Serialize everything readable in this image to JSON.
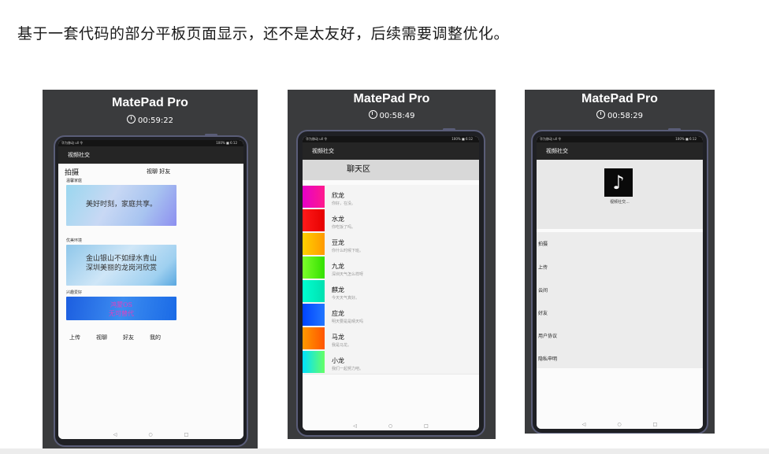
{
  "caption": "基于一套代码的部分平板页面显示，还不是太友好，后续需要调整优化。",
  "device_title": "MatePad Pro",
  "panels": [
    {
      "timer": "00:59:22"
    },
    {
      "timer": "00:58:49"
    },
    {
      "timer": "00:58:29"
    }
  ],
  "status": {
    "left": "华为移动 ull 令",
    "right": "100% ■ 6:12"
  },
  "app_title": "视频社交",
  "nav": {
    "back": "◁",
    "home": "○",
    "recent": "□"
  },
  "colors": {
    "panel_bg": "#3a3b3d",
    "device_frame": "#5a5d78",
    "app_bar": "#252525"
  },
  "screen1": {
    "header_left": "拍摄",
    "header_right": "视聊 好友",
    "sections": [
      {
        "label": "温馨家庭",
        "banner_text": "美好时刻，家庭共享。"
      },
      {
        "label": "优美环境",
        "banner_line1": "金山银山不如绿水青山",
        "banner_line2": "深圳美丽的龙岗河欣赏"
      },
      {
        "label": "兴趣爱好",
        "banner_line1": "鸿蒙OS",
        "banner_line2": "无可替代"
      }
    ],
    "tabs": [
      "上传",
      "视聊",
      "好友",
      "我的"
    ]
  },
  "screen2": {
    "header": "聊天区",
    "chats": [
      {
        "name": "欣龙",
        "msg": "你好，在没。",
        "color_a": "#e600c8",
        "color_b": "#ff1a8c"
      },
      {
        "name": "水龙",
        "msg": "你吃饭了吗。",
        "color_a": "#ff1a1a",
        "color_b": "#e60000"
      },
      {
        "name": "豆龙",
        "msg": "你什么时候下班。",
        "color_a": "#ffd000",
        "color_b": "#ff9900"
      },
      {
        "name": "九龙",
        "msg": "深圳天气怎么样呀",
        "color_a": "#7cff2a",
        "color_b": "#33e000"
      },
      {
        "name": "麒龙",
        "msg": "今天天气真好。",
        "color_a": "#00ffd0",
        "color_b": "#00e0b0"
      },
      {
        "name": "应龙",
        "msg": "明天要是是晴天吗",
        "color_a": "#0044ff",
        "color_b": "#2277ff"
      },
      {
        "name": "马龙",
        "msg": "我是马龙。",
        "color_a": "#ff9900",
        "color_b": "#ff5500"
      },
      {
        "name": "小龙",
        "msg": "我们一起努力吧。",
        "color_a": "#00e0ff",
        "color_b": "#66ff66"
      }
    ]
  },
  "screen3": {
    "logo_icon": "music-note-icon",
    "logo_glyph": "♪",
    "logo_label": "视频社交...",
    "menu": [
      "拍摄",
      "上传",
      "云间",
      "好友",
      "用户协议",
      "隐私申明"
    ]
  }
}
